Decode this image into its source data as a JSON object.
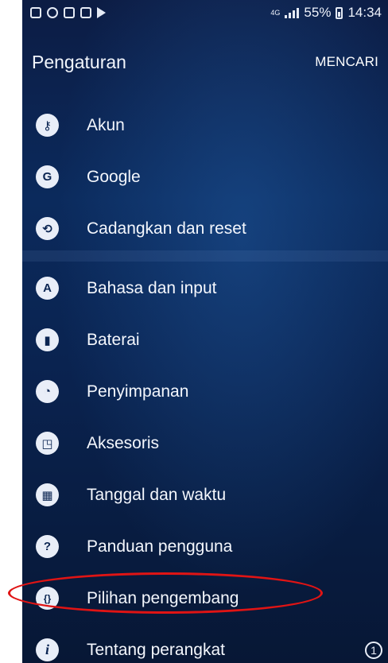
{
  "status_bar": {
    "network": "4G",
    "battery": "55%",
    "time": "14:34"
  },
  "app_bar": {
    "title": "Pengaturan",
    "search_label": "MENCARI"
  },
  "groups": [
    {
      "items": [
        {
          "label": "Akun",
          "icon": "key-icon",
          "glyph": "⚷"
        },
        {
          "label": "Google",
          "icon": "google-icon",
          "glyph": "G"
        },
        {
          "label": "Cadangkan dan reset",
          "icon": "backup-icon",
          "glyph": "⟲"
        }
      ]
    },
    {
      "items": [
        {
          "label": "Bahasa dan input",
          "icon": "language-icon",
          "glyph": "A"
        },
        {
          "label": "Baterai",
          "icon": "battery-icon",
          "glyph": "▮"
        },
        {
          "label": "Penyimpanan",
          "icon": "storage-icon",
          "glyph": "◔"
        },
        {
          "label": "Aksesoris",
          "icon": "accessories-icon",
          "glyph": "◳"
        },
        {
          "label": "Tanggal dan waktu",
          "icon": "calendar-icon",
          "glyph": "▦"
        },
        {
          "label": "Panduan pengguna",
          "icon": "user-manual-icon",
          "glyph": "?"
        },
        {
          "label": "Pilihan pengembang",
          "icon": "developer-options-icon",
          "glyph": "{}"
        },
        {
          "label": "Tentang perangkat",
          "icon": "info-icon",
          "glyph": "i",
          "badge": "1"
        }
      ]
    }
  ]
}
